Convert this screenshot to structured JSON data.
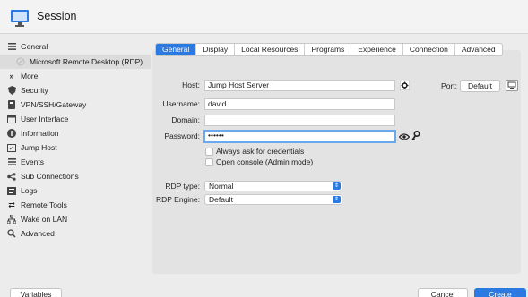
{
  "header": {
    "title": "Session",
    "icon": "monitor-icon"
  },
  "sidebar": {
    "items": [
      {
        "label": "General",
        "icon": "list-icon"
      },
      {
        "label": "Microsoft Remote Desktop (RDP)",
        "icon": "rdp-icon"
      },
      {
        "label": "More",
        "icon": "double-chevron-icon"
      },
      {
        "label": "Security",
        "icon": "shield-icon"
      },
      {
        "label": "VPN/SSH/Gateway",
        "icon": "gateway-icon"
      },
      {
        "label": "User Interface",
        "icon": "window-icon"
      },
      {
        "label": "Information",
        "icon": "info-icon"
      },
      {
        "label": "Jump Host",
        "icon": "jump-host-icon"
      },
      {
        "label": "Events",
        "icon": "events-icon"
      },
      {
        "label": "Sub Connections",
        "icon": "connections-icon"
      },
      {
        "label": "Logs",
        "icon": "logs-icon"
      },
      {
        "label": "Remote Tools",
        "icon": "tools-icon"
      },
      {
        "label": "Wake on LAN",
        "icon": "network-icon"
      },
      {
        "label": "Advanced",
        "icon": "advanced-icon"
      }
    ]
  },
  "tabs": [
    "General",
    "Display",
    "Local Resources",
    "Programs",
    "Experience",
    "Connection",
    "Advanced"
  ],
  "form": {
    "host_label": "Host:",
    "host_value": "Jump Host Server",
    "port_label": "Port:",
    "port_button": "Default",
    "username_label": "Username:",
    "username_value": "david",
    "domain_label": "Domain:",
    "domain_value": "",
    "password_label": "Password:",
    "password_value": "••••••",
    "always_ask_label": "Always ask for credentials",
    "open_console_label": "Open console (Admin mode)",
    "rdp_type_label": "RDP type:",
    "rdp_type_value": "Normal",
    "rdp_engine_label": "RDP Engine:",
    "rdp_engine_value": "Default"
  },
  "footer": {
    "variables": "Variables",
    "cancel": "Cancel",
    "create": "Create"
  },
  "colors": {
    "accent": "#2a7ae2",
    "selected_row": "#dcdcdc"
  }
}
